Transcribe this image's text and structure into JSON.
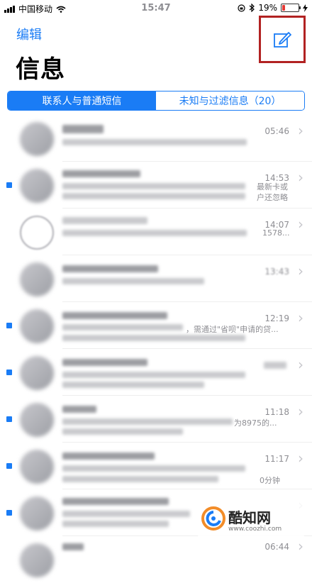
{
  "status_bar": {
    "carrier": "中国移动",
    "time": "15:47",
    "battery_text": "19%",
    "battery_level": 0.19
  },
  "nav": {
    "edit_label": "编辑",
    "title": "信息"
  },
  "segments": [
    {
      "label": "联系人与普通短信",
      "selected": true
    },
    {
      "label": "未知与过滤信息（20）",
      "selected": false
    }
  ],
  "messages": [
    {
      "time": "05:46",
      "unread": false,
      "snippet": ""
    },
    {
      "time": "14:53",
      "unread": true,
      "snippet": "最新卡或\n户还忽略"
    },
    {
      "time": "14:07",
      "unread": false,
      "snippet": "1578..."
    },
    {
      "time": "13:43",
      "unread": false,
      "snippet": ""
    },
    {
      "time": "12:19",
      "unread": true,
      "snippet": "，需通过\"省呗\"申请的贷..."
    },
    {
      "time": "",
      "unread": true,
      "snippet": ""
    },
    {
      "time": "11:18",
      "unread": true,
      "snippet": "为8975的..."
    },
    {
      "time": "11:17",
      "unread": true,
      "snippet": "0分钟"
    },
    {
      "time": "",
      "unread": true,
      "snippet": ""
    },
    {
      "time": "06:44",
      "unread": false,
      "snippet": ""
    }
  ],
  "watermark": {
    "brand": "酷知网",
    "url": "www.coozhi.com"
  },
  "colors": {
    "accent": "#1a7cf5",
    "highlight_box": "#b22222",
    "battery_low": "#e53935"
  }
}
